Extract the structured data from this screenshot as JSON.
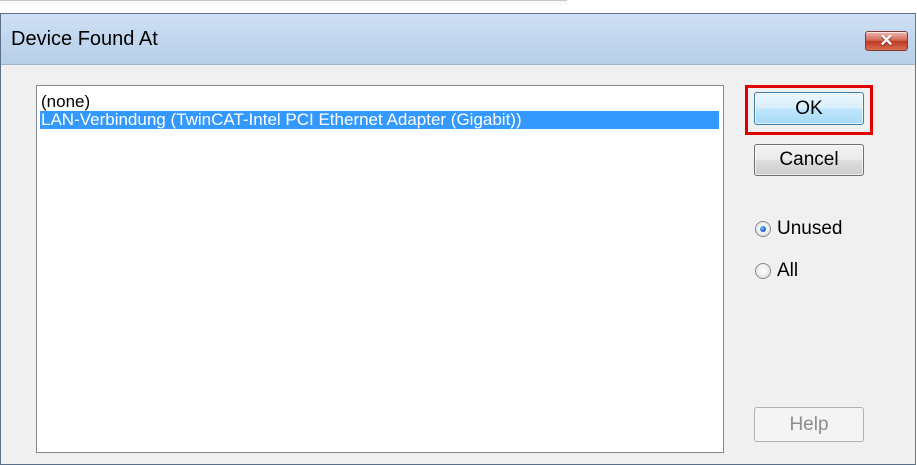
{
  "window": {
    "title": "Device Found At",
    "close_symbol": "✕"
  },
  "device_list": {
    "items": [
      {
        "label": "(none)",
        "selected": false
      },
      {
        "label": "LAN-Verbindung (TwinCAT-Intel PCI Ethernet Adapter (Gigabit))",
        "selected": true
      }
    ]
  },
  "buttons": {
    "ok": "OK",
    "cancel": "Cancel",
    "help": "Help"
  },
  "filter": {
    "unused_label": "Unused",
    "all_label": "All",
    "selected": "Unused"
  },
  "colors": {
    "selection": "#3399ff",
    "focus_outline": "#e00000",
    "disabled_text": "#8d8d8d"
  },
  "icons": {
    "close": "close-icon"
  }
}
